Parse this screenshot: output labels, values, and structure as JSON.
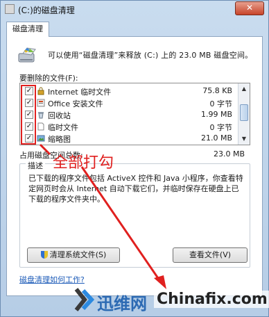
{
  "window": {
    "title": "(C:)的磁盘清理",
    "close_glyph": "✕"
  },
  "tab": {
    "label": "磁盘清理"
  },
  "info": {
    "text": "可以使用“磁盘清理”来释放 (C:) 上的 23.0 MB 磁盘空间。"
  },
  "list": {
    "label": "要删除的文件(F):",
    "items": [
      {
        "name": "Internet 临时文件",
        "size": "75.8 KB",
        "checked": true,
        "icon": "lock-icon"
      },
      {
        "name": "Office 安装文件",
        "size": "0 字节",
        "checked": true,
        "icon": "office-icon"
      },
      {
        "name": "回收站",
        "size": "1.99 MB",
        "checked": true,
        "icon": "recycle-bin-icon"
      },
      {
        "name": "临时文件",
        "size": "0 字节",
        "checked": true,
        "icon": "file-icon"
      },
      {
        "name": "缩略图",
        "size": "21.0 MB",
        "checked": true,
        "icon": "thumbnail-icon"
      }
    ]
  },
  "total": {
    "label": "占用磁盘空间总数:",
    "value": "23.0 MB"
  },
  "description": {
    "label": "描述",
    "text": "已下载的程序文件包括 ActiveX 控件和 Java 小程序，你查看特定网页时会从 Internet 自动下载它们，并临时保存在硬盘上已下载的程序文件夹中。"
  },
  "buttons": {
    "clean_system": "清理系统文件(S)",
    "view_files": "查看文件(V)"
  },
  "help": {
    "link": "磁盘清理如何工作?"
  },
  "annotation": {
    "text": "全部打勾",
    "color": "#e0201f"
  },
  "watermark": {
    "cn": "迅维网",
    "en": "Chinafix.com"
  }
}
